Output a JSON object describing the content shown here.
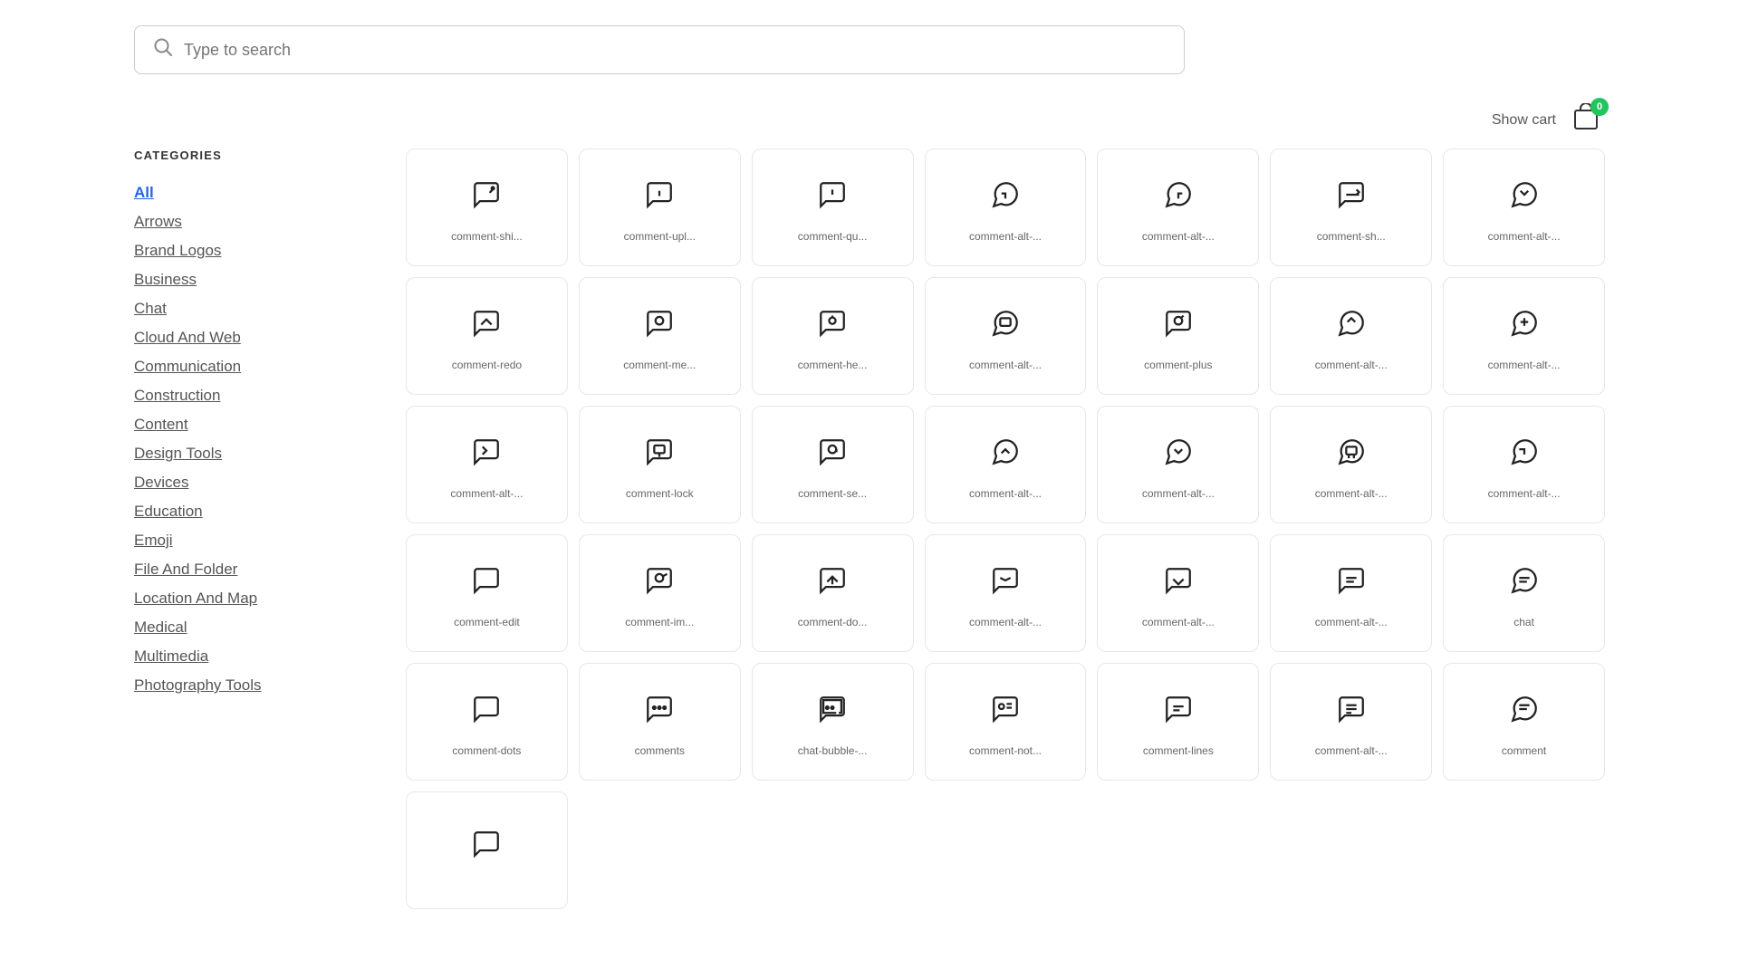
{
  "search": {
    "placeholder": "Type to search"
  },
  "cart": {
    "show_label": "Show cart",
    "badge": "0"
  },
  "sidebar": {
    "heading": "CATEGORIES",
    "items": [
      {
        "id": "all",
        "label": "All",
        "active": true
      },
      {
        "id": "arrows",
        "label": "Arrows",
        "active": false
      },
      {
        "id": "brand-logos",
        "label": "Brand Logos",
        "active": false
      },
      {
        "id": "business",
        "label": "Business",
        "active": false
      },
      {
        "id": "chat",
        "label": "Chat",
        "active": false
      },
      {
        "id": "cloud-and-web",
        "label": "Cloud And Web",
        "active": false
      },
      {
        "id": "communication",
        "label": "Communication",
        "active": false
      },
      {
        "id": "construction",
        "label": "Construction",
        "active": false
      },
      {
        "id": "content",
        "label": "Content",
        "active": false
      },
      {
        "id": "design-tools",
        "label": "Design Tools",
        "active": false
      },
      {
        "id": "devices",
        "label": "Devices",
        "active": false
      },
      {
        "id": "education",
        "label": "Education",
        "active": false
      },
      {
        "id": "emoji",
        "label": "Emoji",
        "active": false
      },
      {
        "id": "file-and-folder",
        "label": "File And Folder",
        "active": false
      },
      {
        "id": "location-and-map",
        "label": "Location And Map",
        "active": false
      },
      {
        "id": "medical",
        "label": "Medical",
        "active": false
      },
      {
        "id": "multimedia",
        "label": "Multimedia",
        "active": false
      },
      {
        "id": "photography-tools",
        "label": "Photography Tools",
        "active": false
      }
    ]
  },
  "icons": [
    {
      "label": "comment-shi...",
      "glyph": "↻💬"
    },
    {
      "label": "comment-upl...",
      "glyph": "↑💬"
    },
    {
      "label": "comment-qu...",
      "glyph": "?💬"
    },
    {
      "label": "comment-alt-...",
      "glyph": "↩🗨"
    },
    {
      "label": "comment-alt-...",
      "glyph": "↩🗨"
    },
    {
      "label": "comment-sh...",
      "glyph": "↻💬"
    },
    {
      "label": "comment-alt-...",
      "glyph": "↩🗨"
    },
    {
      "label": "comment-redo",
      "glyph": "↻💬"
    },
    {
      "label": "comment-me...",
      "glyph": "🔍💬"
    },
    {
      "label": "comment-he...",
      "glyph": "🔍💬"
    },
    {
      "label": "comment-alt-...",
      "glyph": "🖼🗨"
    },
    {
      "label": "comment-plus",
      "glyph": "+💬"
    },
    {
      "label": "comment-alt-...",
      "glyph": "⬆🗨"
    },
    {
      "label": "comment-alt-...",
      "glyph": "🔒🗨"
    },
    {
      "label": "comment-alt-...",
      "glyph": "↩🗨"
    },
    {
      "label": "comment-lock",
      "glyph": "🔒💬"
    },
    {
      "label": "comment-se...",
      "glyph": "↻💬"
    },
    {
      "label": "comment-alt-...",
      "glyph": "↩🗨"
    },
    {
      "label": "comment-alt-...",
      "glyph": "⬆🗨"
    },
    {
      "label": "comment-alt-...",
      "glyph": "⬆🗨"
    },
    {
      "label": "comment-alt-...",
      "glyph": "🖼🗨"
    },
    {
      "label": "comment-edit",
      "glyph": "✏💬"
    },
    {
      "label": "comment-im...",
      "glyph": "🌐💬"
    },
    {
      "label": "comment-do...",
      "glyph": "↻💬"
    },
    {
      "label": "comment-alt-...",
      "glyph": "↩🗨"
    },
    {
      "label": "comment-alt-...",
      "glyph": "↩🗨"
    },
    {
      "label": "comment-alt-...",
      "glyph": "💬"
    },
    {
      "label": "chat",
      "glyph": "💬"
    },
    {
      "label": "comment-dots",
      "glyph": "💬"
    },
    {
      "label": "comments",
      "glyph": "💬"
    },
    {
      "label": "chat-bubble-...",
      "glyph": "💬"
    },
    {
      "label": "comment-not...",
      "glyph": "💬"
    },
    {
      "label": "comment-lines",
      "glyph": "💬"
    },
    {
      "label": "comment-alt-...",
      "glyph": "🗨"
    },
    {
      "label": "comment",
      "glyph": "💬"
    }
  ]
}
